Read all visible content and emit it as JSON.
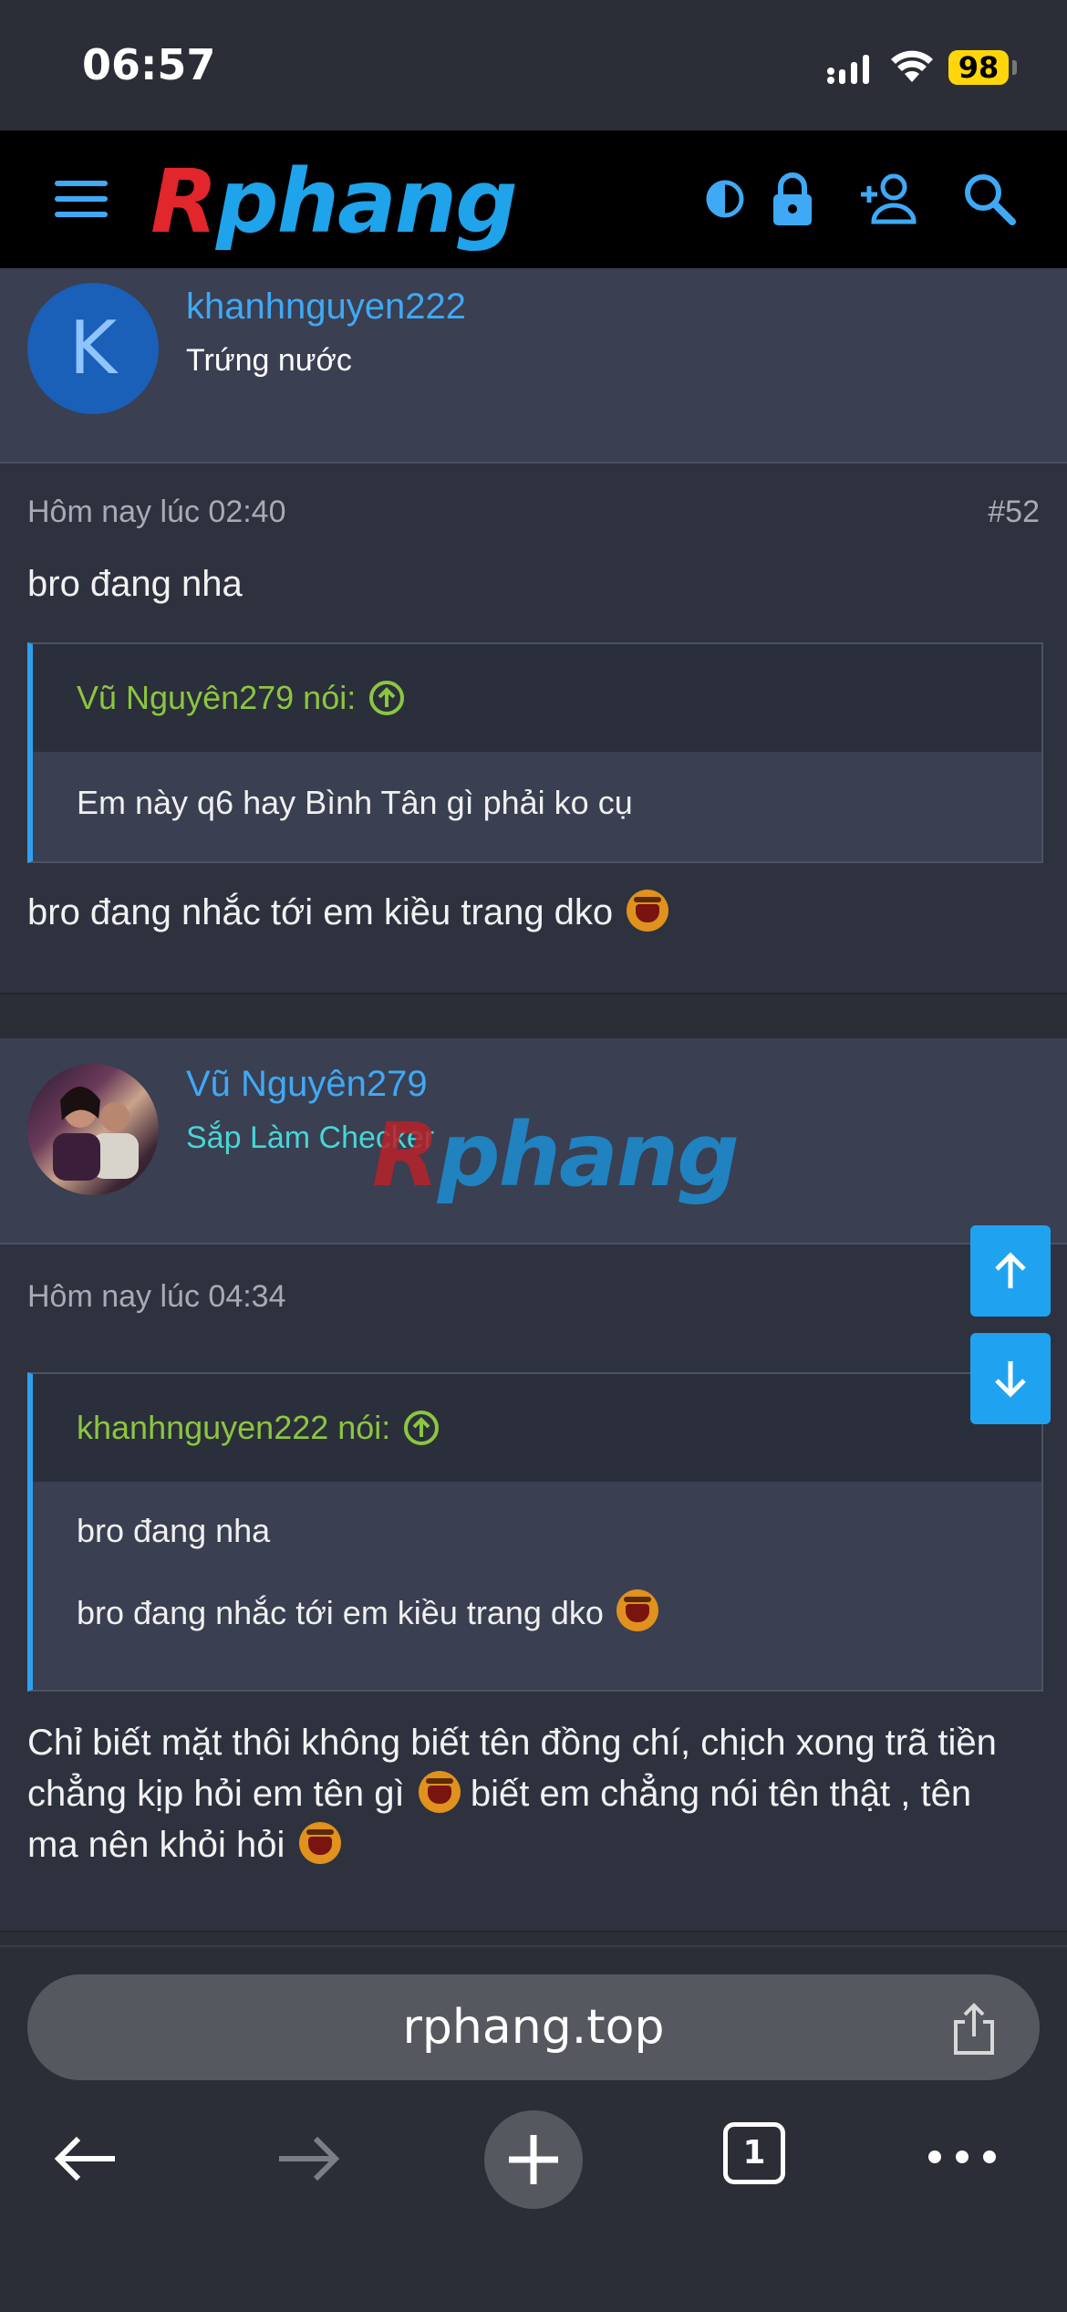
{
  "status_bar": {
    "time": "06:57",
    "battery": "98"
  },
  "header": {
    "logo_r": "R",
    "logo_rest": "phang"
  },
  "post1_user": {
    "avatar_letter": "K",
    "username": "khanhnguyen222",
    "title": "Trứng nước"
  },
  "post1": {
    "date": "Hôm nay lúc 02:40",
    "number": "#52",
    "intro": "bro đang nha",
    "quote_author": "Vũ Nguyên279 nói:",
    "quote_text": "Em này q6 hay Bình Tân gì phải ko cụ",
    "reply": "bro đang nhắc tới em kiều trang dko"
  },
  "post2_user": {
    "username": "Vũ Nguyên279",
    "title": "Sắp Làm Checker"
  },
  "post2": {
    "date": "Hôm nay lúc 04:34",
    "quote_author": "khanhnguyen222 nói:",
    "quote_line1": "bro đang nha",
    "quote_line2": "bro đang nhắc tới em kiều trang dko",
    "reply_part1": "Chỉ biết mặt thôi không biết tên đồng chí, chịch xong trã tiền chẳng kịp hỏi em tên gì",
    "reply_part2": "biết em chẳng nói tên thật , tên ma nên khỏi hỏi"
  },
  "watermark": {
    "r": "R",
    "rest": "phang"
  },
  "browser": {
    "url": "rphang.top",
    "tab_count": "1"
  },
  "colors": {
    "accent": "#3fa9f5",
    "quote_author": "#8cc63f",
    "user_title_2": "#47d6d6"
  },
  "icons": [
    "menu-icon",
    "theme-toggle-icon",
    "lock-icon",
    "add-user-icon",
    "search-icon",
    "arrow-up-icon",
    "arrow-down-icon",
    "share-icon",
    "back-icon",
    "forward-icon",
    "new-tab-icon",
    "tabs-icon",
    "more-icon"
  ]
}
